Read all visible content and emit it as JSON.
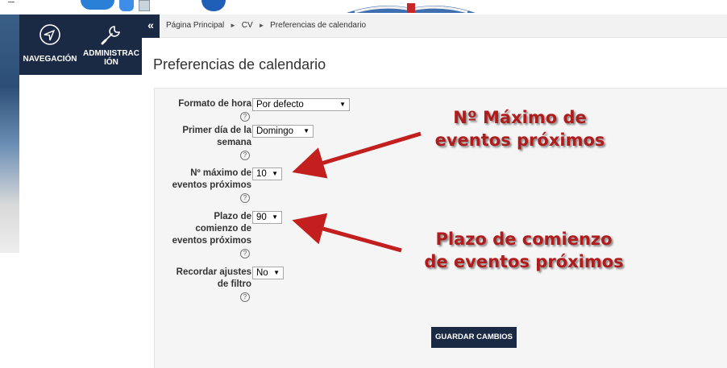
{
  "nav": {
    "navegacion_label": "NAVEGACIÓN",
    "administracion_label": "ADMINISTRACIÓN",
    "collapse_symbol": "«"
  },
  "breadcrumb": {
    "items": [
      "Página Principal",
      "CV",
      "Preferencias de calendario"
    ],
    "separator": "►"
  },
  "page_title": "Preferencias de calendario",
  "form": {
    "fields": [
      {
        "label": "Formato de hora",
        "value": "Por defecto"
      },
      {
        "label": "Primer día de la semana",
        "value": "Domingo"
      },
      {
        "label": "Nº máximo de eventos próximos",
        "value": "10"
      },
      {
        "label": "Plazo de comienzo de eventos próximos",
        "value": "90"
      },
      {
        "label": "Recordar ajustes de filtro",
        "value": "No"
      }
    ],
    "help_symbol": "?",
    "caret_symbol": "▼",
    "save_button": "GUARDAR CAMBIOS"
  },
  "annotations": {
    "note1_line1": "Nº Máximo de",
    "note1_line2": "eventos próximos",
    "note2_line1": "Plazo de comienzo",
    "note2_line2": "de eventos próximos"
  },
  "colors": {
    "nav_bg": "#1b2a44",
    "annotation_red": "#b01c1c",
    "arrow_red": "#c41f1f"
  }
}
